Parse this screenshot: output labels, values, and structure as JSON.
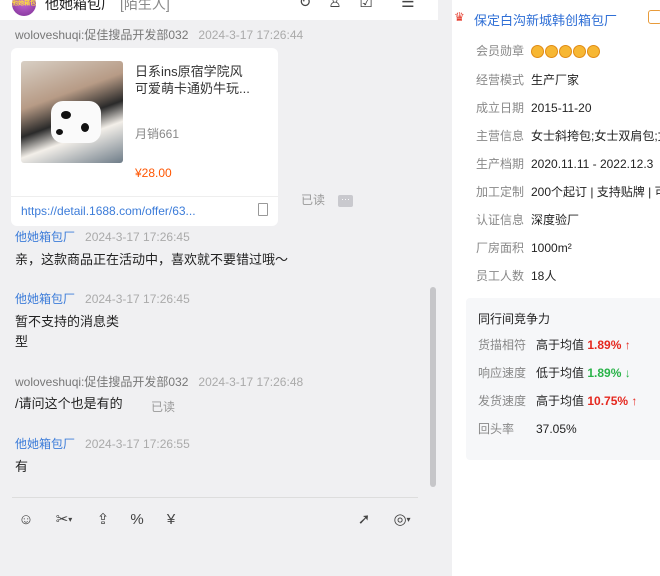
{
  "header": {
    "avatar_text": "他她箱包",
    "title": "他她箱包厂",
    "subtitle": "[陌生人]"
  },
  "messages": [
    {
      "sender": "woloveshuqi:促佳搜品开发部032",
      "time": "2024-3-17 17:26:44"
    },
    {
      "sender": "他她箱包厂",
      "time": "2024-3-17 17:26:45",
      "text": "亲，这款商品正在活动中，喜欢就不要错过哦～"
    },
    {
      "sender": "他她箱包厂",
      "time": "2024-3-17 17:26:45",
      "text_line1": "暂不支持的消息类",
      "text_line2": "型"
    },
    {
      "sender": "woloveshuqi:促佳搜品开发部032",
      "time": "2024-3-17 17:26:48",
      "text": "/请问这个也是有的",
      "read": "已读"
    },
    {
      "sender": "他她箱包厂",
      "time": "2024-3-17 17:26:55",
      "text": "有"
    }
  ],
  "product_card": {
    "title_line1": "日系ins原宿学院风",
    "title_line2": "可爱萌卡通奶牛玩...",
    "sales": "月销661",
    "price": "¥28.00",
    "url": "https://detail.1688.com/offer/63...",
    "read": "已读"
  },
  "shop": {
    "name": "保定白沟新城韩创箱包厂",
    "colors": {
      "link": "#2f6fd6",
      "red": "#e5281f",
      "green": "#2ab34a"
    }
  },
  "info_rows": {
    "medal": {
      "label": "会员勋章",
      "count": 5
    },
    "mode": {
      "label": "经营模式",
      "value": "生产厂家"
    },
    "founded": {
      "label": "成立日期",
      "value": "2015-11-20"
    },
    "products": {
      "label": "主营信息",
      "value": "女士斜挎包;女士双肩包;女"
    },
    "schedule": {
      "label": "生产档期",
      "value": "2020.11.11 - 2022.12.3"
    },
    "custom": {
      "label": "加工定制",
      "value": "200个起订 | 支持贴牌 | 可"
    },
    "cert": {
      "label": "认证信息",
      "value": "深度验厂"
    },
    "area": {
      "label": "厂房面积",
      "value": "1000m²"
    },
    "staff": {
      "label": "员工人数",
      "value": "18人"
    }
  },
  "compete": {
    "title": "同行间竞争力",
    "rows": [
      {
        "label": "货描相符",
        "cmp": "高于均值",
        "value": "1.89%",
        "arrow": "↑"
      },
      {
        "label": "响应速度",
        "cmp": "低于均值",
        "value": "1.89%",
        "arrow": "↓"
      },
      {
        "label": "发货速度",
        "cmp": "高于均值",
        "value": "10.75%",
        "arrow": "↑"
      },
      {
        "label": "回头率",
        "value": "37.05%"
      }
    ]
  }
}
